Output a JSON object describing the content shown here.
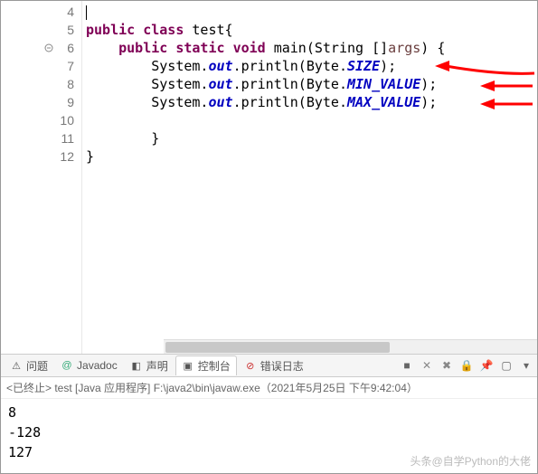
{
  "gutter": {
    "lines": [
      "4",
      "5",
      "6",
      "7",
      "8",
      "9",
      "10",
      "11",
      "12"
    ]
  },
  "code": {
    "l5": {
      "kw1": "public",
      "kw2": "class",
      "cls": "test",
      "tail": "{"
    },
    "l6": {
      "kw1": "public",
      "kw2": "static",
      "kw3": "void",
      "m": "main",
      "p1": "(String []",
      "arg": "args",
      "p2": ") {"
    },
    "l7": {
      "pre": "System.",
      "out": "out",
      "mid": ".println(Byte.",
      "fld": "SIZE",
      "post": ");"
    },
    "l8": {
      "pre": "System.",
      "out": "out",
      "mid": ".println(Byte.",
      "fld": "MIN_VALUE",
      "post": ");"
    },
    "l9": {
      "pre": "System.",
      "out": "out",
      "mid": ".println(Byte.",
      "fld": "MAX_VALUE",
      "post": ");"
    },
    "l11": {
      "txt": "}"
    },
    "l12": {
      "txt": "}"
    }
  },
  "tabs": {
    "problems": "问题",
    "javadoc": "Javadoc",
    "decl": "声明",
    "console": "控制台",
    "errorlog": "错误日志"
  },
  "console": {
    "header": "<已终止> test [Java 应用程序] F:\\java2\\bin\\javaw.exe（2021年5月25日 下午9:42:04）",
    "out1": "8",
    "out2": "-128",
    "out3": "127"
  },
  "watermark": "头条@自学Python的大佬"
}
